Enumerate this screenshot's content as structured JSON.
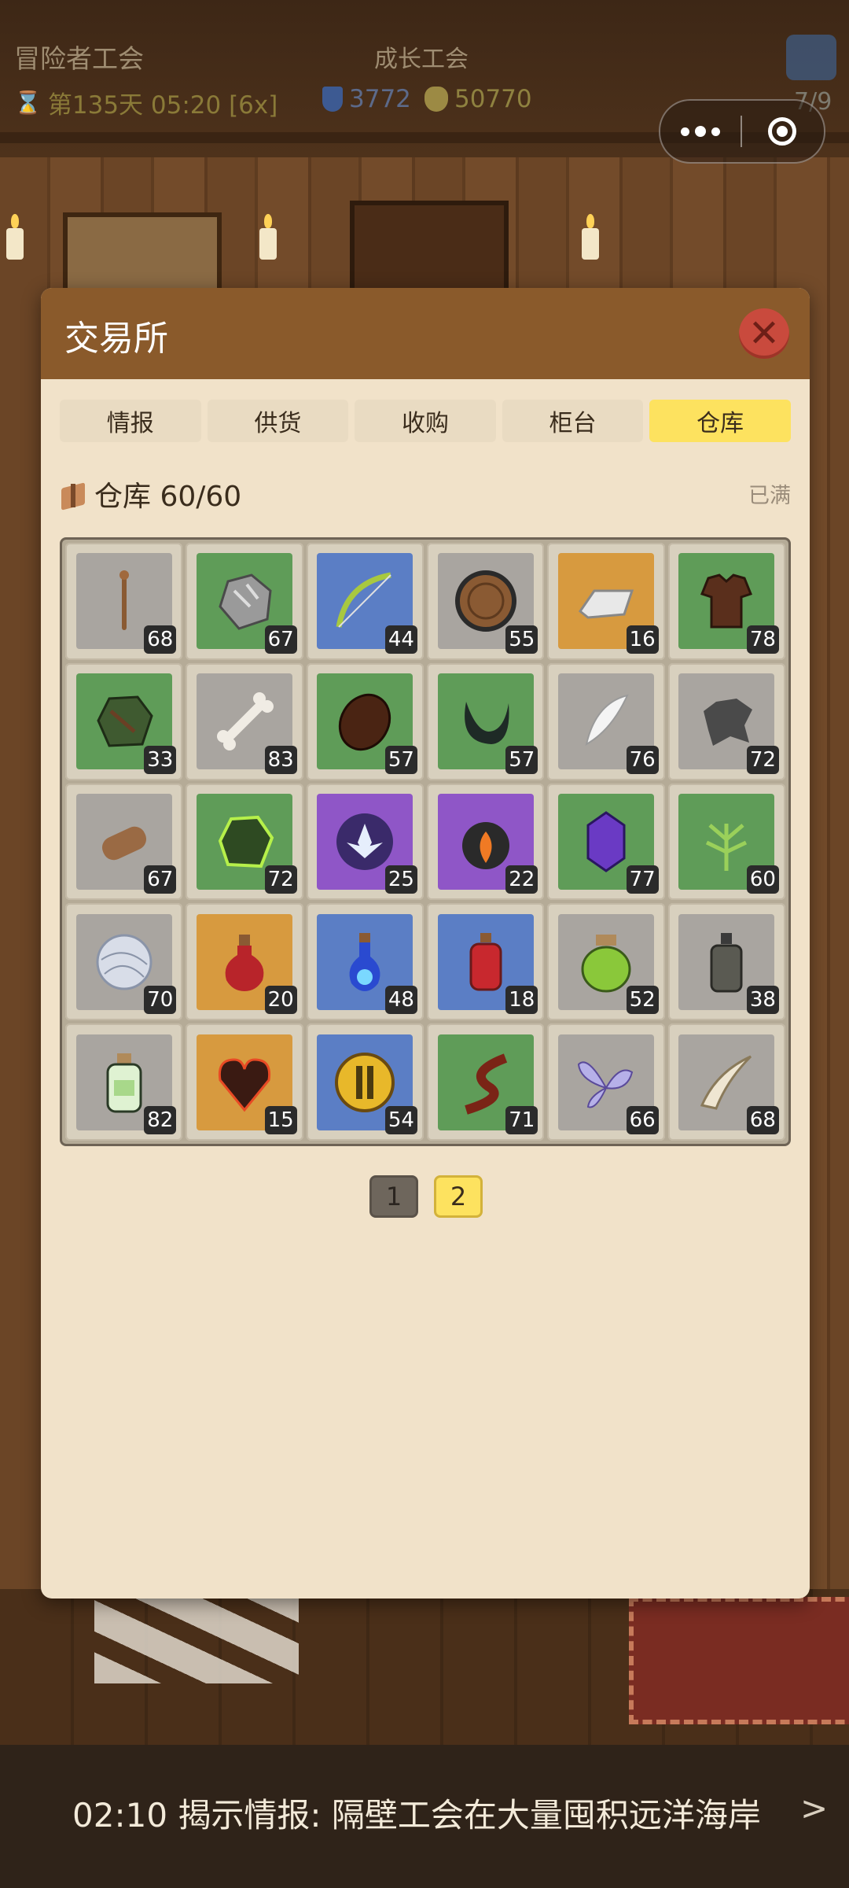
{
  "status": {
    "guild_name": "冒险者工会",
    "guild_rank": "成长工会",
    "day_text": "第135天 05:20 [6x]",
    "reputation": "3772",
    "gold": "50770",
    "slot_count": "7/9"
  },
  "modal": {
    "title": "交易所",
    "tabs": [
      {
        "label": "情报",
        "active": false
      },
      {
        "label": "供货",
        "active": false
      },
      {
        "label": "收购",
        "active": false
      },
      {
        "label": "柜台",
        "active": false
      },
      {
        "label": "仓库",
        "active": true
      }
    ],
    "warehouse_title": "仓库 60/60",
    "status_label": "已满",
    "items": [
      {
        "name": "wooden-staff",
        "qty": "68",
        "bg": "gray"
      },
      {
        "name": "stone-ore",
        "qty": "67",
        "bg": "green"
      },
      {
        "name": "green-bow",
        "qty": "44",
        "bg": "blue"
      },
      {
        "name": "wooden-shield",
        "qty": "55",
        "bg": "gray"
      },
      {
        "name": "silver-ingot",
        "qty": "16",
        "bg": "orange"
      },
      {
        "name": "leather-armor",
        "qty": "78",
        "bg": "green"
      },
      {
        "name": "moss-ore",
        "qty": "33",
        "bg": "green"
      },
      {
        "name": "bone",
        "qty": "83",
        "bg": "gray"
      },
      {
        "name": "beetle-shell",
        "qty": "57",
        "bg": "green"
      },
      {
        "name": "black-horn",
        "qty": "57",
        "bg": "green"
      },
      {
        "name": "white-feather",
        "qty": "76",
        "bg": "gray"
      },
      {
        "name": "beast-hide",
        "qty": "72",
        "bg": "gray"
      },
      {
        "name": "leather-scroll",
        "qty": "67",
        "bg": "gray"
      },
      {
        "name": "glowing-ore",
        "qty": "72",
        "bg": "green"
      },
      {
        "name": "lotus-gem",
        "qty": "25",
        "bg": "purple"
      },
      {
        "name": "fire-lantern",
        "qty": "22",
        "bg": "purple"
      },
      {
        "name": "purple-crystal",
        "qty": "77",
        "bg": "green"
      },
      {
        "name": "green-herb",
        "qty": "60",
        "bg": "green"
      },
      {
        "name": "silver-thread",
        "qty": "70",
        "bg": "gray"
      },
      {
        "name": "red-potion",
        "qty": "20",
        "bg": "orange"
      },
      {
        "name": "blue-potion",
        "qty": "48",
        "bg": "blue"
      },
      {
        "name": "red-vial",
        "qty": "18",
        "bg": "blue"
      },
      {
        "name": "green-jar",
        "qty": "52",
        "bg": "gray"
      },
      {
        "name": "dark-bottle",
        "qty": "38",
        "bg": "gray"
      },
      {
        "name": "small-green-bottle",
        "qty": "82",
        "bg": "gray"
      },
      {
        "name": "lava-heart",
        "qty": "15",
        "bg": "orange"
      },
      {
        "name": "gold-coin",
        "qty": "54",
        "bg": "blue"
      },
      {
        "name": "red-rope",
        "qty": "71",
        "bg": "green"
      },
      {
        "name": "insect-wing",
        "qty": "66",
        "bg": "gray"
      },
      {
        "name": "fang-tooth",
        "qty": "68",
        "bg": "gray"
      }
    ],
    "pages": [
      {
        "label": "1",
        "active": false
      },
      {
        "label": "2",
        "active": true
      }
    ]
  },
  "ticker": {
    "text": "02:10 揭示情报: 隔壁工会在大量囤积远洋海岸",
    "arrow": ">"
  },
  "colors": {
    "header": "#8a5a2b",
    "panel": "#f1e2c9",
    "tab_active": "#fde25f",
    "close": "#c94a3d"
  }
}
